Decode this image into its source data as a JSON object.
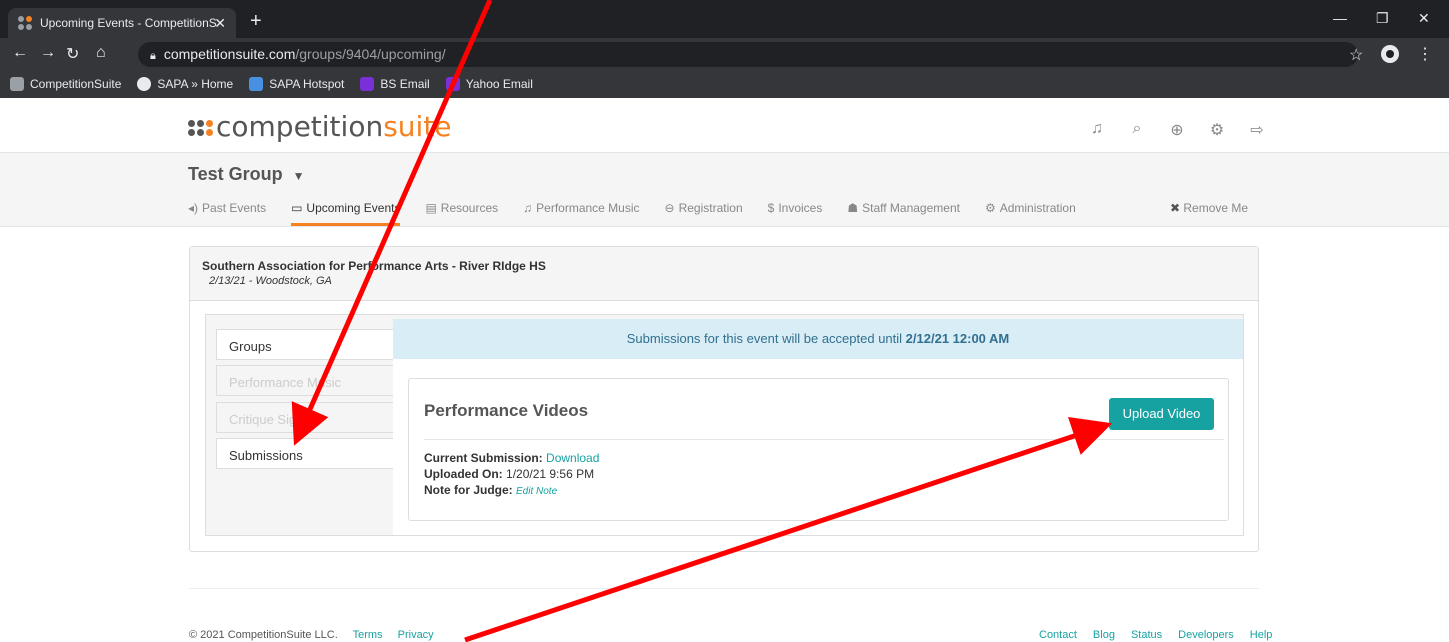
{
  "browser": {
    "tab_title": "Upcoming Events - CompetitionS",
    "url_host": "competitionsuite.com",
    "url_path": "/groups/9404/upcoming/",
    "bookmarks": [
      "CompetitionSuite",
      "SAPA » Home",
      "SAPA Hotspot",
      "BS Email",
      "Yahoo Email"
    ]
  },
  "site": {
    "logo_main": "competition",
    "logo_accent": "suite",
    "top_icons": [
      "music-icon",
      "search-icon",
      "help-icon",
      "settings-icon",
      "logout-icon"
    ]
  },
  "group": {
    "name": "Test Group",
    "tabs": [
      {
        "icon": "◂)",
        "label": "Past Events"
      },
      {
        "icon": "▭",
        "label": "Upcoming Events"
      },
      {
        "icon": "▤",
        "label": "Resources"
      },
      {
        "icon": "♫",
        "label": "Performance Music"
      },
      {
        "icon": "⊖",
        "label": "Registration"
      },
      {
        "icon": "$",
        "label": "Invoices"
      },
      {
        "icon": "☗",
        "label": "Staff Management"
      },
      {
        "icon": "⚙",
        "label": "Administration"
      }
    ],
    "remove_label": "Remove Me"
  },
  "event": {
    "title": "Southern Association for Performance Arts - River RIdge HS",
    "subtitle": "2/13/21 - Woodstock, GA",
    "side_items": [
      "Groups",
      "Performance Music",
      "Critique Sign",
      "Submissions"
    ],
    "alert_prefix": "Submissions for this event will be accepted until",
    "alert_deadline": "2/12/21 12:00 AM",
    "videos": {
      "title": "Performance Videos",
      "upload_label": "Upload Video",
      "current_label": "Current Submission:",
      "current_link": "Download",
      "uploaded_label": "Uploaded On:",
      "uploaded_value": "1/20/21 9:56 PM",
      "note_label": "Note for Judge:",
      "note_link": "Edit Note"
    }
  },
  "footer": {
    "copyright": "© 2021 CompetitionSuite LLC.",
    "left_links": [
      "Terms",
      "Privacy"
    ],
    "right_links": [
      "Contact",
      "Blog",
      "Status",
      "Developers",
      "Help"
    ]
  },
  "colors": {
    "accent": "#f58220",
    "teal": "#17a2a2",
    "arrow": "#ff0000"
  }
}
